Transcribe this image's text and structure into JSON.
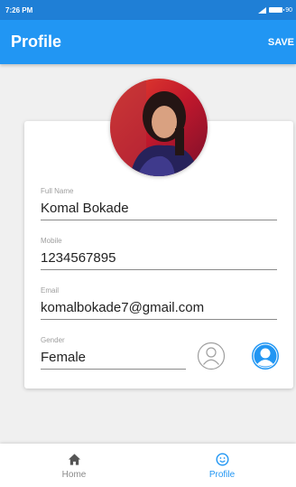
{
  "status_bar": {
    "time": "7:26 PM",
    "battery": "90"
  },
  "app_bar": {
    "title": "Profile",
    "save_label": "SAVE"
  },
  "profile": {
    "avatar_icon": "user-photo",
    "fields": [
      {
        "label": "Full Name",
        "value": "Komal Bokade"
      },
      {
        "label": "Mobile",
        "value": "1234567895"
      },
      {
        "label": "Email",
        "value": "komalbokade7@gmail.com"
      },
      {
        "label": "Gender",
        "value": "Female"
      }
    ],
    "gender_options": [
      {
        "icon": "male-person-outline-icon",
        "selected": false
      },
      {
        "icon": "female-person-filled-icon",
        "selected": true
      }
    ]
  },
  "bottom_nav": {
    "items": [
      {
        "label": "Home",
        "icon": "home-icon",
        "active": false
      },
      {
        "label": "Profile",
        "icon": "smiley-icon",
        "active": true
      }
    ]
  },
  "colors": {
    "primary": "#2196f3",
    "status_bar": "#1f7fd6",
    "inactive_nav": "#8a8a8a"
  }
}
